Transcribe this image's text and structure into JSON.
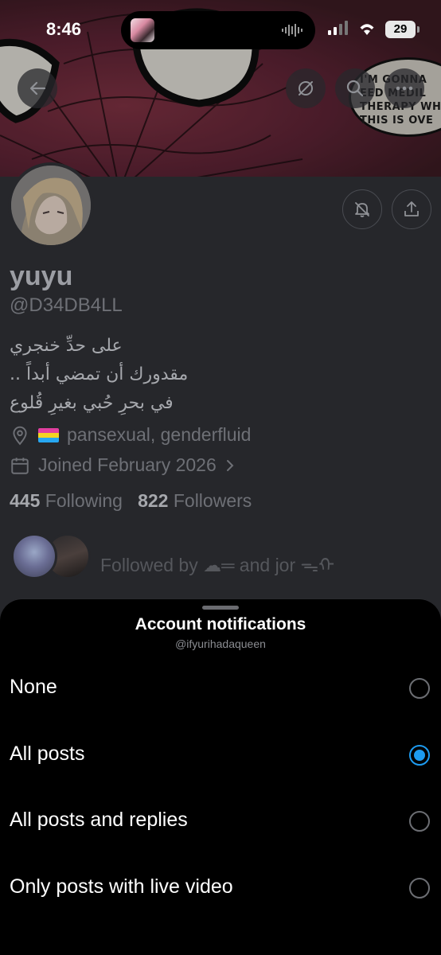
{
  "status_bar": {
    "time": "8:46",
    "battery": "29"
  },
  "banner": {
    "bubble_text": [
      "I'M GONNA",
      "EED MEDIL",
      "THERAPY WH",
      "THIS IS OVE"
    ]
  },
  "header_actions": {
    "back_icon": "arrow-left-icon",
    "grok_icon": "slash-circle-icon",
    "search_icon": "search-icon",
    "more_icon": "more-dots-icon"
  },
  "profile": {
    "name": "yuyu",
    "handle": "@D34DB4LL",
    "bio": [
      "على حدِّ خنجري",
      "مقدورك أن تمضي أبداً ..",
      "في بحرِ حُبي بغيرِ قُلوع"
    ],
    "location": "pansexual, genderfluid",
    "joined": "Joined February 2026",
    "following_count": "445",
    "following_label": "Following",
    "followers_count": "822",
    "followers_label": "Followers",
    "followed_by": "Followed by ☁═ and jor ᯓᡣ"
  },
  "sheet": {
    "title": "Account notifications",
    "subtitle": "@ifyurihadaqueen",
    "options": [
      {
        "label": "None",
        "selected": false
      },
      {
        "label": "All posts",
        "selected": true
      },
      {
        "label": "All posts and replies",
        "selected": false
      },
      {
        "label": "Only posts with live video",
        "selected": false
      }
    ]
  },
  "colors": {
    "accent": "#1d9bf0",
    "sheet_background": "#000000",
    "dimmed_background": "#26272b"
  }
}
